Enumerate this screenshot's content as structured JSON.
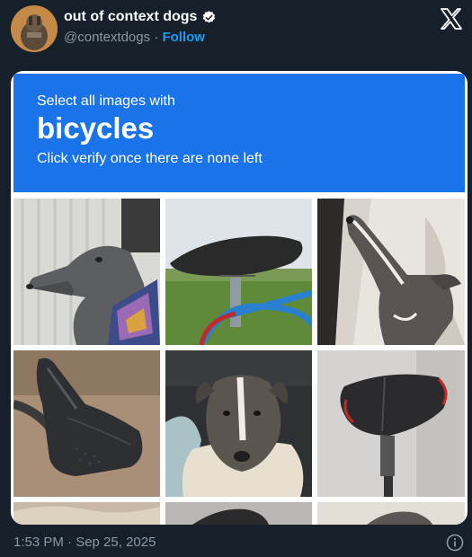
{
  "post": {
    "display_name": "out of context dogs",
    "handle": "@contextdogs",
    "separator": "·",
    "follow_label": "Follow",
    "timestamp": "1:53 PM · Sep 25, 2025"
  },
  "captcha": {
    "instruction": "Select all images with",
    "keyword": "bicycles",
    "subtext": "Click verify once there are none left"
  },
  "colors": {
    "background": "#15202b",
    "captcha_blue": "#1a73e8",
    "link": "#1d9bf0",
    "muted_text": "#8b98a5"
  },
  "icons": {
    "verified": "verified-badge-icon",
    "close": "x-logo-icon",
    "info": "info-icon"
  },
  "tiles": [
    {
      "name": "tile-greyhound-scarf",
      "subject": "dog"
    },
    {
      "name": "tile-bicycle-seat-field",
      "subject": "bicycle seat"
    },
    {
      "name": "tile-greyhound-looking-up",
      "subject": "dog"
    },
    {
      "name": "tile-black-saddle-closeup",
      "subject": "bicycle seat"
    },
    {
      "name": "tile-greyhound-blanket",
      "subject": "dog"
    },
    {
      "name": "tile-red-black-saddle",
      "subject": "bicycle seat"
    },
    {
      "name": "tile-partial-left",
      "subject": ""
    },
    {
      "name": "tile-partial-middle",
      "subject": ""
    },
    {
      "name": "tile-partial-right",
      "subject": ""
    }
  ]
}
